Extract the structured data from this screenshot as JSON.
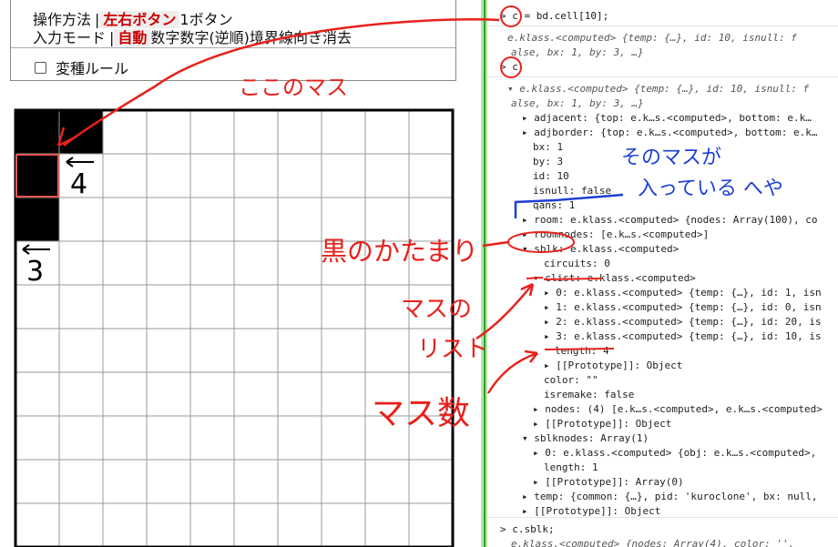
{
  "menu": {
    "row1_label": "操作方法",
    "row1_sep": "|",
    "row1_selected": "左右ボタン",
    "row1_other": "1ボタン",
    "row2_label": "入力モード",
    "row2_sep": "|",
    "row2_selected": "自動",
    "row2_options": [
      "数字",
      "数字(逆順)",
      "境界線",
      "向き",
      "消去"
    ],
    "variant_rule": "変種ルール"
  },
  "board": {
    "rows": 10,
    "cols": 10,
    "black_cells": [
      [
        0,
        0
      ],
      [
        0,
        1
      ],
      [
        1,
        0
      ],
      [
        2,
        0
      ]
    ],
    "selected_cell": [
      1,
      0
    ],
    "clues": [
      {
        "row": 1,
        "col": 1,
        "number": "4",
        "arrow": "left"
      },
      {
        "row": 3,
        "col": 0,
        "number": "3",
        "arrow": "left"
      }
    ]
  },
  "console": {
    "lines": [
      {
        "t": "> c = bd.cell[10];"
      },
      {
        "t": "e.klass.<computed> {temp: {…}, id: 10, isnull: f"
      },
      {
        "t": "alse, bx: 1, by: 3, …}"
      },
      {
        "t": "> c"
      },
      {
        "t": "▾ e.klass.<computed> {temp: {…}, id: 10, isnull: f"
      },
      {
        "t": "alse, bx: 1, by: 3, …}"
      },
      {
        "t": "▸ adjacent: {top: e.k…s.<computed>, bottom: e.k…"
      },
      {
        "t": "▸ adjborder: {top: e.k…s.<computed>, bottom: e.k…"
      },
      {
        "t": "bx: 1"
      },
      {
        "t": "by: 3"
      },
      {
        "t": "id: 10"
      },
      {
        "t": "isnull: false"
      },
      {
        "t": "qans: 1"
      },
      {
        "t": "▸ room: e.klass.<computed> {nodes: Array(100), co"
      },
      {
        "t": "▸ roomnodes: [e.k…s.<computed>]"
      },
      {
        "t": "▾ sblk: e.klass.<computed>"
      },
      {
        "t": "circuits: 0"
      },
      {
        "t": "▾ clist: e.klass.<computed>"
      },
      {
        "t": "▸ 0: e.klass.<computed> {temp: {…}, id: 1, isn"
      },
      {
        "t": "▸ 1: e.klass.<computed> {temp: {…}, id: 0, isn"
      },
      {
        "t": "▸ 2: e.klass.<computed> {temp: {…}, id: 20, is"
      },
      {
        "t": "▸ 3: e.klass.<computed> {temp: {…}, id: 10, is"
      },
      {
        "t": "length: 4"
      },
      {
        "t": "▸ [[Prototype]]: Object"
      },
      {
        "t": "color: \"\""
      },
      {
        "t": "isremake: false"
      },
      {
        "t": "▸ nodes: (4) [e.k…s.<computed>, e.k…s.<computed>"
      },
      {
        "t": "▸ [[Prototype]]: Object"
      },
      {
        "t": "▾ sblknodes: Array(1)"
      },
      {
        "t": "▸ 0: e.klass.<computed> {obj: e.k…s.<computed>,"
      },
      {
        "t": "length: 1"
      },
      {
        "t": "▸ [[Prototype]]: Array(0)"
      },
      {
        "t": "▸ temp: {common: {…}, pid: 'kuroclone', bx: null,"
      },
      {
        "t": "▸ [[Prototype]]: Object"
      },
      {
        "t": "> c.sblk;"
      },
      {
        "t": "e.klass.<computed> {nodes: Array(4), color: '',"
      }
    ]
  },
  "annotations": {
    "this_cell": "ここのマス",
    "room_note_1": "そのマスが",
    "room_note_2": "入っている へや",
    "black_group": "黒のかたまり",
    "cell_list_1": "マスの",
    "cell_list_2": "リスト",
    "cell_count": "マス数"
  },
  "colors": {
    "annotation_red": "#e8211b",
    "annotation_blue": "#1d3fd6",
    "selected_cell": "#e05555",
    "divider_green": "#2aa52a"
  }
}
